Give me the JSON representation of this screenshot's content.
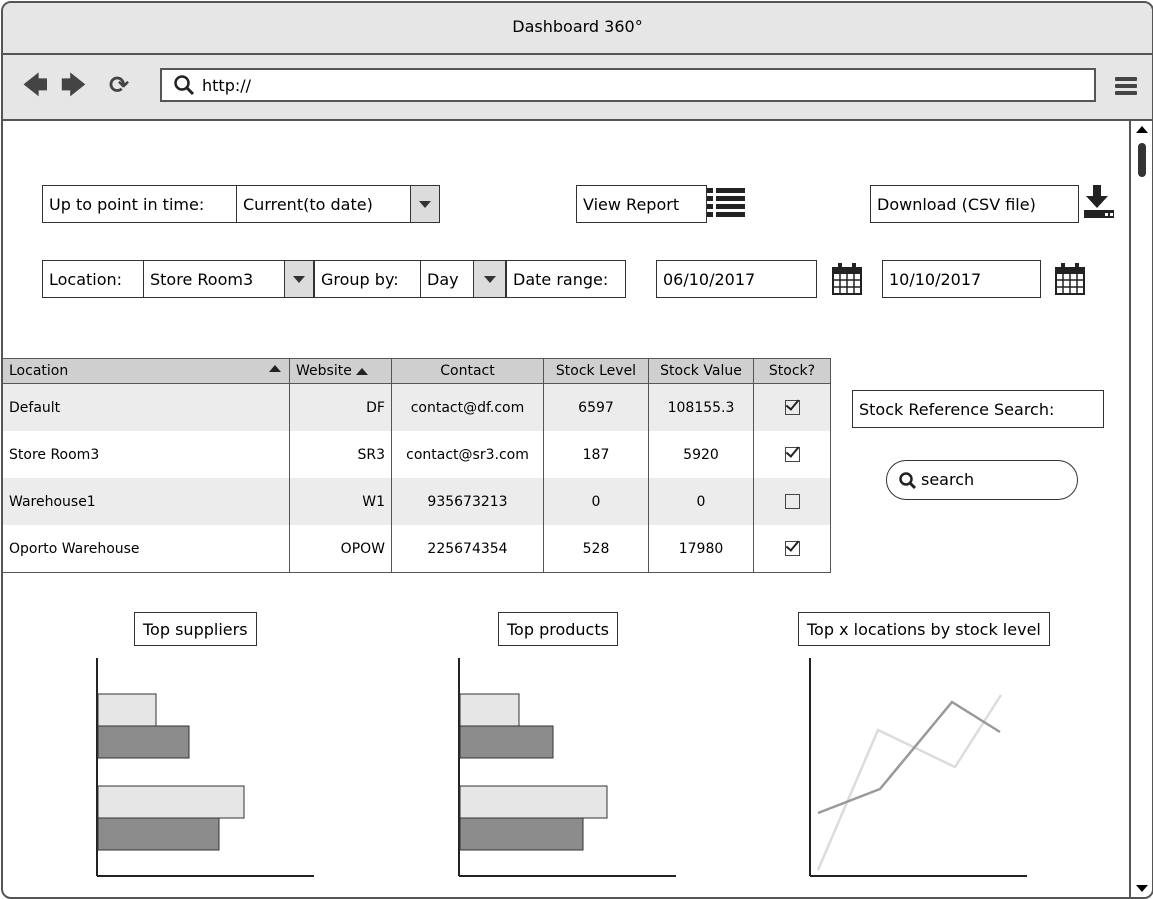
{
  "window": {
    "title": "Dashboard 360°"
  },
  "browser": {
    "url_value": "http://",
    "back_icon": "back-arrow-icon",
    "forward_icon": "forward-arrow-icon",
    "reload_icon": "reload-icon",
    "search_icon": "magnifier-icon",
    "menu_icon": "hamburger-menu-icon"
  },
  "controls": {
    "point_in_time_label": "Up to point in time:",
    "point_in_time_value": "Current(to date)",
    "view_report_label": "View Report",
    "download_label": "Download (CSV file)",
    "location_label": "Location:",
    "location_value": "Store Room3",
    "group_by_label": "Group by:",
    "group_by_value": "Day",
    "date_range_label": "Date range:",
    "date_from": "06/10/2017",
    "date_to": "10/10/2017"
  },
  "table": {
    "columns": [
      "Location",
      "Website",
      "Contact",
      "Stock Level",
      "Stock Value",
      "Stock?"
    ],
    "rows": [
      {
        "location": "Default",
        "website": "DF",
        "contact": "contact@df.com",
        "stock_level": "6597",
        "stock_value": "108155.3",
        "stock": true
      },
      {
        "location": "Store Room3",
        "website": "SR3",
        "contact": "contact@sr3.com",
        "stock_level": "187",
        "stock_value": "5920",
        "stock": true
      },
      {
        "location": "Warehouse1",
        "website": "W1",
        "contact": "935673213",
        "stock_level": "0",
        "stock_value": "0",
        "stock": false
      },
      {
        "location": "Oporto Warehouse",
        "website": "OPOW",
        "contact": "225674354",
        "stock_level": "528",
        "stock_value": "17980",
        "stock": true
      }
    ]
  },
  "stock_search": {
    "label": "Stock Reference Search:",
    "placeholder": "search"
  },
  "charts": {
    "suppliers_title": "Top suppliers",
    "products_title": "Top products",
    "locations_title": "Top x locations by stock level"
  },
  "colors": {
    "frame": "#555555",
    "chrome": "#e6e6e6",
    "bar_light": "#e6e6e6",
    "bar_dark": "#8c8c8c",
    "row_alt": "#ececec"
  }
}
